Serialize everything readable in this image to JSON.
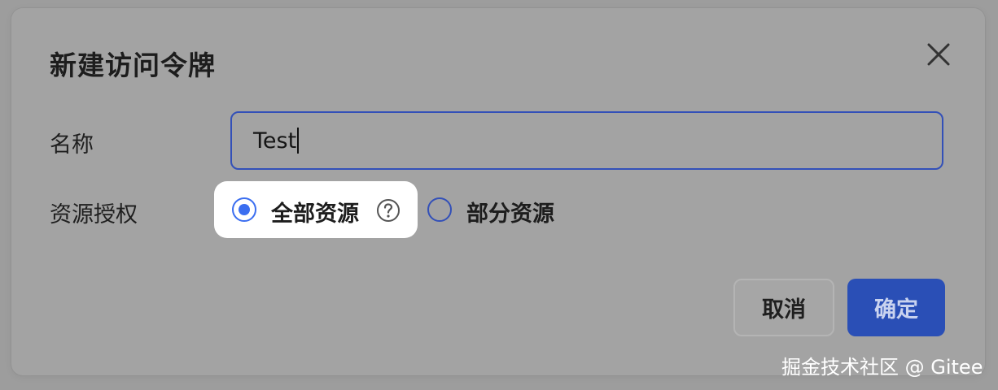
{
  "dialog": {
    "title": "新建访问令牌",
    "close_icon": "close-icon"
  },
  "form": {
    "name_label": "名称",
    "name_value": "Test",
    "auth_label": "资源授权",
    "options": [
      {
        "label": "全部资源",
        "checked": true,
        "has_help": true
      },
      {
        "label": "部分资源",
        "checked": false
      }
    ],
    "help_icon": "question-circle-icon"
  },
  "buttons": {
    "cancel_label": "取消",
    "confirm_label": "确定"
  },
  "colors": {
    "primary": "#2a4fb6",
    "radio_active": "#3b6ef0",
    "overlay": "#a3a3a3"
  },
  "watermark": "掘金技术社区 @ Gitee"
}
